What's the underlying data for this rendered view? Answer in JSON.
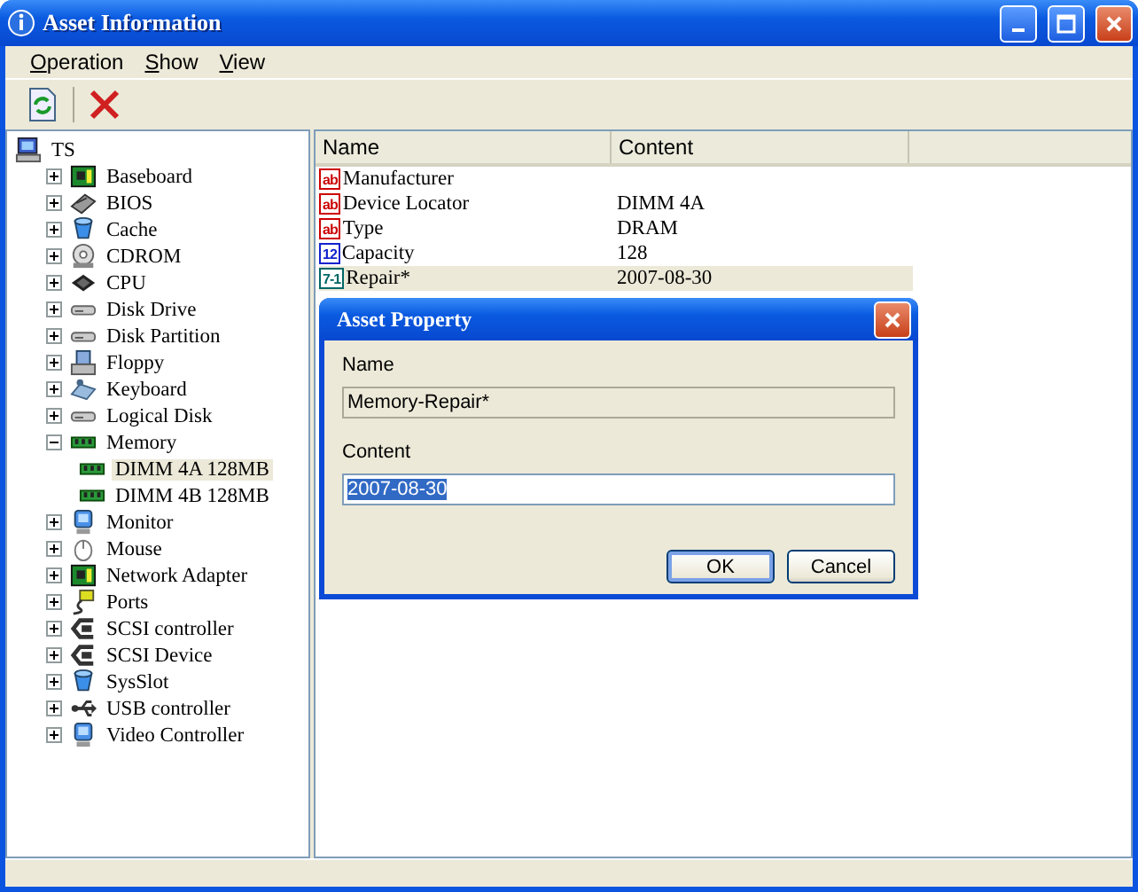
{
  "window": {
    "title": "Asset Information"
  },
  "menu": [
    "Operation",
    "Show",
    "View"
  ],
  "toolbar": [
    {
      "kind": "refresh"
    },
    {
      "kind": "delete"
    }
  ],
  "tree": [
    {
      "label": "TS",
      "kind": "computer",
      "selected": false,
      "children": [
        {
          "label": "Baseboard",
          "kind": "board",
          "expanded": false,
          "selected": false
        },
        {
          "label": "BIOS",
          "kind": "chip",
          "expanded": false,
          "selected": false
        },
        {
          "label": "Cache",
          "kind": "bucket",
          "expanded": false,
          "selected": false
        },
        {
          "label": "CDROM",
          "kind": "disc",
          "expanded": false,
          "selected": false
        },
        {
          "label": "CPU",
          "kind": "cpu",
          "expanded": false,
          "selected": false
        },
        {
          "label": "Disk Drive",
          "kind": "drive",
          "expanded": false,
          "selected": false
        },
        {
          "label": "Disk Partition",
          "kind": "drive",
          "expanded": false,
          "selected": false
        },
        {
          "label": "Floppy",
          "kind": "floppy",
          "expanded": false,
          "selected": false
        },
        {
          "label": "Keyboard",
          "kind": "keyboard",
          "expanded": false,
          "selected": false
        },
        {
          "label": "Logical Disk",
          "kind": "drive",
          "expanded": false,
          "selected": false
        },
        {
          "label": "Memory",
          "kind": "ram",
          "expanded": true,
          "selected": false,
          "children": [
            {
              "label": "DIMM 4A 128MB",
              "kind": "ram",
              "selected": true
            },
            {
              "label": "DIMM 4B 128MB",
              "kind": "ram",
              "selected": false
            }
          ]
        },
        {
          "label": "Monitor",
          "kind": "monitor",
          "expanded": false,
          "selected": false
        },
        {
          "label": "Mouse",
          "kind": "mouse",
          "expanded": false,
          "selected": false
        },
        {
          "label": "Network Adapter",
          "kind": "board",
          "expanded": false,
          "selected": false
        },
        {
          "label": "Ports",
          "kind": "plug",
          "expanded": false,
          "selected": false
        },
        {
          "label": "SCSI controller",
          "kind": "scsi",
          "expanded": false,
          "selected": false
        },
        {
          "label": "SCSI Device",
          "kind": "scsi",
          "expanded": false,
          "selected": false
        },
        {
          "label": "SysSlot",
          "kind": "bucket",
          "expanded": false,
          "selected": false
        },
        {
          "label": "USB controller",
          "kind": "usb",
          "expanded": false,
          "selected": false
        },
        {
          "label": "Video Controller",
          "kind": "monitor",
          "expanded": false,
          "selected": false
        }
      ]
    }
  ],
  "table": {
    "columns": [
      "Name",
      "Content"
    ],
    "rows": [
      {
        "kind": "text",
        "badge": "ab",
        "name": "Manufacturer",
        "selected": false
      },
      {
        "kind": "text",
        "badge": "ab",
        "name": "Device Locator",
        "content": "DIMM 4A",
        "selected": false
      },
      {
        "kind": "text",
        "badge": "ab",
        "name": "Type",
        "content": "DRAM",
        "selected": false
      },
      {
        "kind": "number",
        "badge": "12",
        "name": "Capacity",
        "content": "128",
        "selected": false
      },
      {
        "kind": "date",
        "badge": "7-1",
        "name": "Repair*",
        "content": "2007-08-30",
        "selected": true
      }
    ]
  },
  "dialog": {
    "title": "Asset Property",
    "name_label": "Name",
    "name_value": "Memory-Repair*",
    "content_label": "Content",
    "content_value": "2007-08-30",
    "buttons": [
      {
        "label": "OK",
        "default": true
      },
      {
        "label": "Cancel",
        "default": false
      }
    ]
  }
}
